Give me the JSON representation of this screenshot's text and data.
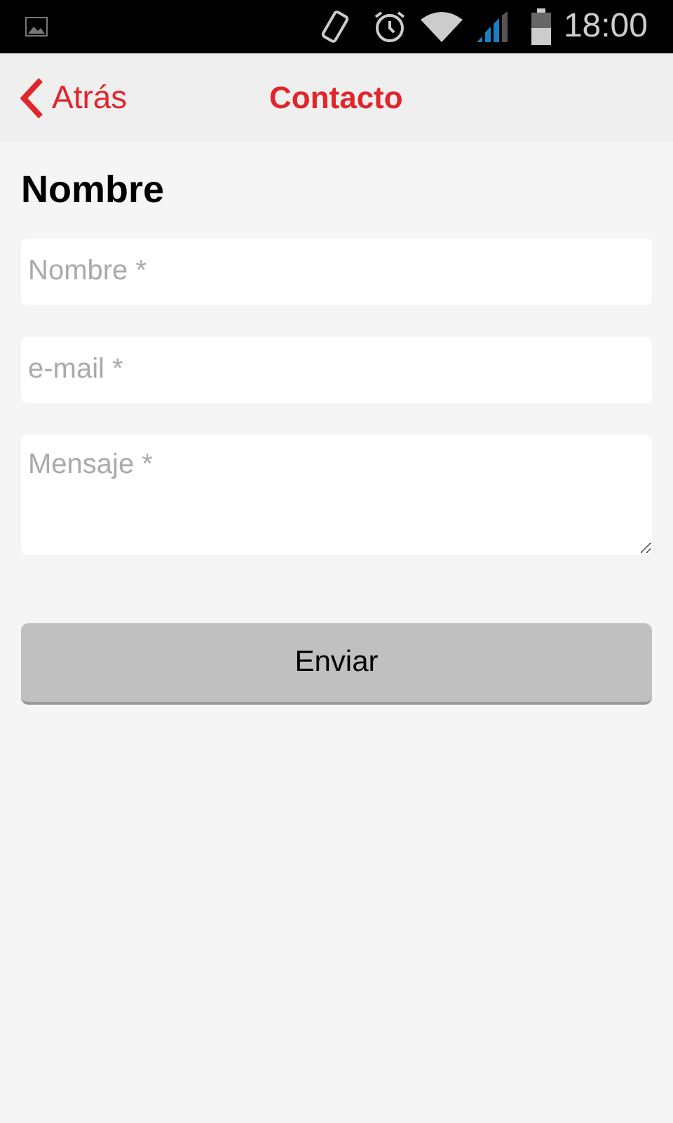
{
  "status_bar": {
    "time": "18:00"
  },
  "nav_bar": {
    "back": "Atrás",
    "title": "Contacto"
  },
  "heading": "Nombre",
  "fields": [
    {
      "kind": "input",
      "placeholder": "Nombre *"
    },
    {
      "kind": "input",
      "placeholder": "e-mail *"
    },
    {
      "kind": "textarea",
      "placeholder": "Mensaje *"
    }
  ],
  "button": "Enviar"
}
